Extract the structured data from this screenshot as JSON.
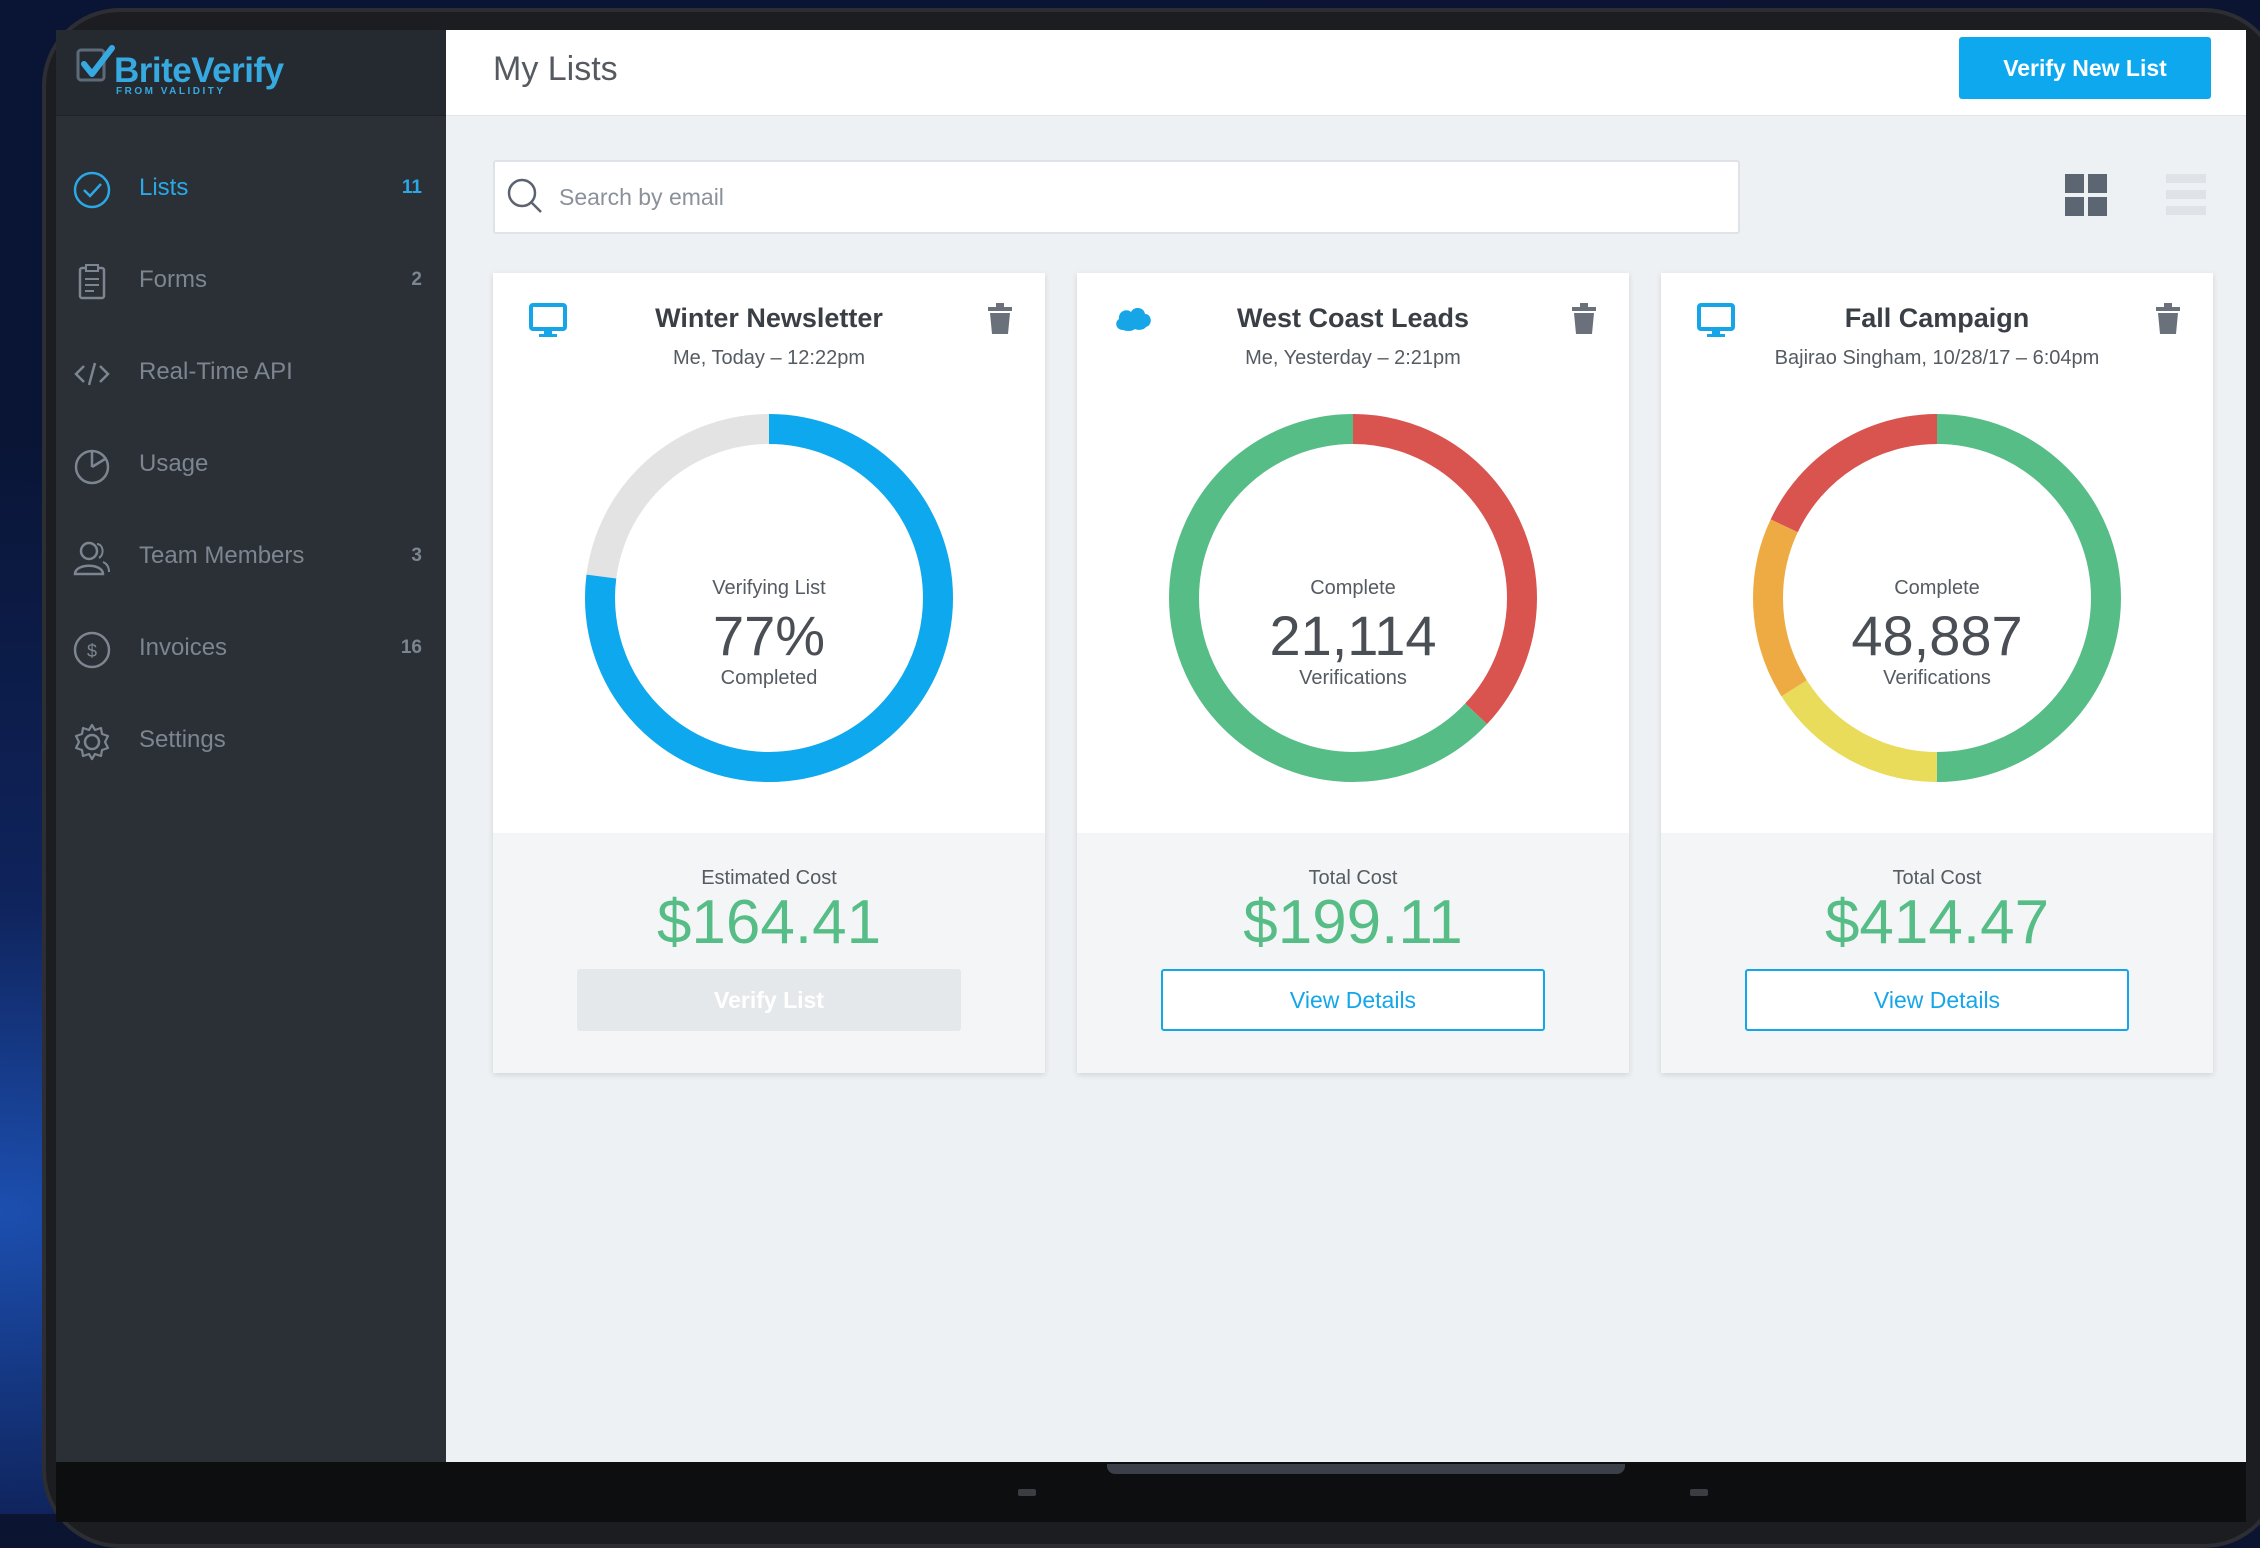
{
  "brand": {
    "name": "BriteVerify",
    "tagline": "FROM VALIDITY",
    "color": "#36a9e1"
  },
  "sidebar": {
    "items": [
      {
        "label": "Lists",
        "count": "11",
        "icon": "check-circle-icon",
        "active": true
      },
      {
        "label": "Forms",
        "count": "2",
        "icon": "clipboard-icon"
      },
      {
        "label": "Real-Time API",
        "count": "",
        "icon": "code-icon"
      },
      {
        "label": "Usage",
        "count": "",
        "icon": "pie-chart-icon"
      },
      {
        "label": "Team Members",
        "count": "3",
        "icon": "users-icon"
      },
      {
        "label": "Invoices",
        "count": "16",
        "icon": "dollar-icon"
      },
      {
        "label": "Settings",
        "count": "",
        "icon": "gear-icon"
      }
    ]
  },
  "header": {
    "title": "My Lists",
    "primary_button": "Verify New List"
  },
  "search": {
    "placeholder": "Search by email"
  },
  "view_toggles": [
    "grid-view-icon",
    "list-view-icon"
  ],
  "colors": {
    "accent": "#0ea8ee",
    "green": "#57bd86",
    "red": "#d9534f",
    "orange": "#efab43",
    "yellow": "#e8dc5a",
    "gray": "#e3e3e3"
  },
  "cards": [
    {
      "title": "Winter Newsletter",
      "subtitle": "Me, Today – 12:22pm",
      "source_icon": "monitor-icon",
      "donut_top": "Verifying List",
      "donut_value": "77%",
      "donut_bottom": "Completed",
      "progress": 0.77,
      "cost_label": "Estimated Cost",
      "cost": "$164.41",
      "button": "Verify List",
      "button_enabled": false
    },
    {
      "title": "West Coast Leads",
      "subtitle": "Me, Yesterday – 2:21pm",
      "source_icon": "cloud-icon",
      "donut_top": "Complete",
      "donut_value": "21,114",
      "donut_bottom": "Verifications",
      "segments": [
        {
          "status": "invalid",
          "fraction": 0.37,
          "color": "#d9534f"
        },
        {
          "status": "valid",
          "fraction": 0.63,
          "color": "#57bd86"
        }
      ],
      "cost_label": "Total Cost",
      "cost": "$199.11",
      "button": "View Details",
      "button_enabled": true
    },
    {
      "title": "Fall Campaign",
      "subtitle": "Bajirao Singham, 10/28/17 – 6:04pm",
      "source_icon": "monitor-icon",
      "donut_top": "Complete",
      "donut_value": "48,887",
      "donut_bottom": "Verifications",
      "segments": [
        {
          "status": "valid",
          "fraction": 0.5,
          "color": "#57bd86"
        },
        {
          "status": "unknown",
          "fraction": 0.16,
          "color": "#e8dc5a"
        },
        {
          "status": "accept-all",
          "fraction": 0.16,
          "color": "#efab43"
        },
        {
          "status": "invalid",
          "fraction": 0.18,
          "color": "#d9534f"
        }
      ],
      "cost_label": "Total Cost",
      "cost": "$414.47",
      "button": "View Details",
      "button_enabled": true
    }
  ]
}
